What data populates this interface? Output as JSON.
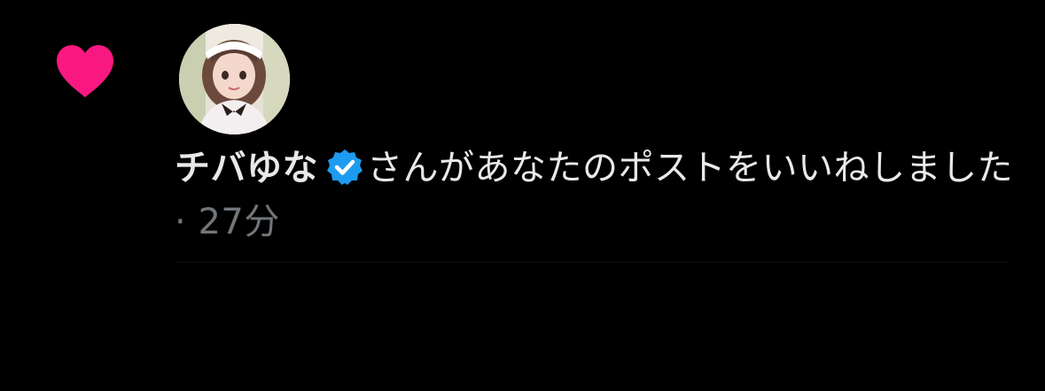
{
  "notification": {
    "type_icon": "heart-icon",
    "avatar_icon": "user-avatar",
    "user_name": "チバゆな",
    "verified_icon": "verified-badge-icon",
    "message": "さんがあなたのポストをいいねしました",
    "separator": " · ",
    "timestamp": "27分"
  },
  "colors": {
    "background": "#000000",
    "heart": "#f91880",
    "verified": "#1d9bf0",
    "text": "#e7e9ea",
    "muted": "#71767b"
  }
}
